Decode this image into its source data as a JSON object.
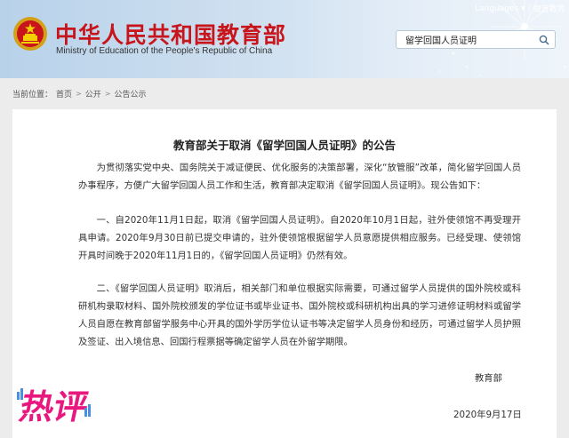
{
  "header": {
    "cn_title": "中华人民共和国教育部",
    "en_title": "Ministry of Education of the People's Republic of China",
    "languages_label": "Languages",
    "wechat_label": "微言教育",
    "search_value": "留学回国人员证明"
  },
  "breadcrumb": {
    "prefix": "当前位置：",
    "items": [
      "首页",
      "公开",
      "公告公示"
    ]
  },
  "article": {
    "title": "教育部关于取消《留学回国人员证明》的公告",
    "paragraphs": [
      "为贯彻落实党中央、国务院关于减证便民、优化服务的决策部署，深化“放管服”改革，简化留学回国人员办事程序，方便广大留学回国人员工作和生活，教育部决定取消《留学回国人员证明》。现公告如下：",
      "一、自2020年11月1日起，取消《留学回国人员证明》。自2020年10月1日起，驻外使领馆不再受理开具申请。2020年9月30日前已提交申请的，驻外使领馆根据留学人员意愿提供相应服务。已经受理、使领馆开具时间晚于2020年11月1日的，《留学回国人员证明》仍然有效。",
      "二、《留学回国人员证明》取消后，相关部门和单位根据实际需要，可通过留学人员提供的国外院校或科研机构录取材料、国外院校颁发的学位证书或毕业证书、国外院校或科研机构出具的学习进修证明材料或留学人员自愿在教育部留学服务中心开具的国外学历学位认证书等决定留学人员身份和经历，可通过留学人员护照及签证、出入境信息、回国行程票据等确定留学人员在外留学期限。"
    ],
    "signature": "教育部",
    "date": "2020年9月17日"
  },
  "badge": {
    "text": "热评"
  },
  "colors": {
    "brand_red": "#c8151b",
    "header_blue": "#b8d2ea",
    "badge_pink": "#e8187f"
  }
}
